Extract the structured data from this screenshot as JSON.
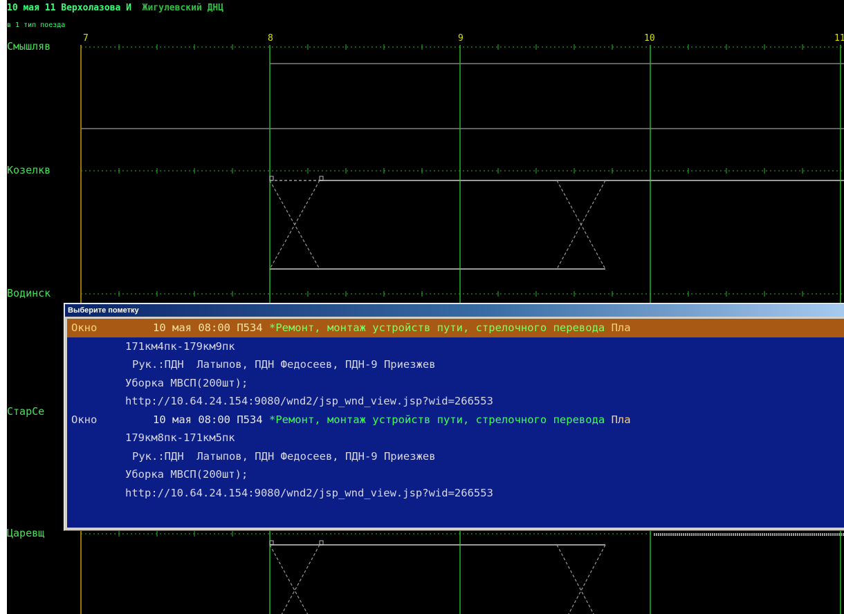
{
  "header": {
    "date_line": "10 мая 11 Верхолазова И",
    "dept": "Жигулевский ДНЦ",
    "sub_line": "в 1 тип поезда"
  },
  "axis": {
    "hours": [
      "7",
      "8",
      "9",
      "10",
      "11"
    ]
  },
  "stations": [
    "Смышляв",
    "Козелкв",
    "Водинск",
    "СтарСе",
    "Царевщ"
  ],
  "dialog": {
    "title": "Выберите пометку",
    "items": [
      {
        "type": "Окно",
        "date": "10 мая 08:00 П534",
        "desc": "*Ремонт, монтаж устройств пути, стрелочного перевода",
        "tail": "Пла",
        "km": "171км4пк-179км9пк",
        "leaders": "Рук.:ПДН  Латыпов, ПДН Федосеев, ПДН-9 Приезжев",
        "cleanup": "Уборка МВСП(200шт);",
        "url": "http://10.64.24.154:9080/wnd2/jsp_wnd_view.jsp?wid=266553"
      },
      {
        "type": "Окно",
        "date": "10 мая 08:00 П534",
        "desc": "*Ремонт, монтаж устройств пути, стрелочного перевода",
        "tail": "Пла",
        "km": "179км8пк-171км5пк",
        "leaders": "Рук.:ПДН  Латыпов, ПДН Федосеев, ПДН-9 Приезжев",
        "cleanup": "Уборка МВСП(200шт);",
        "url": "http://10.64.24.154:9080/wnd2/jsp_wnd_view.jsp?wid=266553"
      }
    ]
  },
  "colors": {
    "background": "#000000",
    "grid_green": "#1fb81f",
    "station_text": "#46e058",
    "hour_label": "#d8e000",
    "dialog_list_bg": "#0b1d86",
    "selected_row_bg": "#a85a14"
  }
}
